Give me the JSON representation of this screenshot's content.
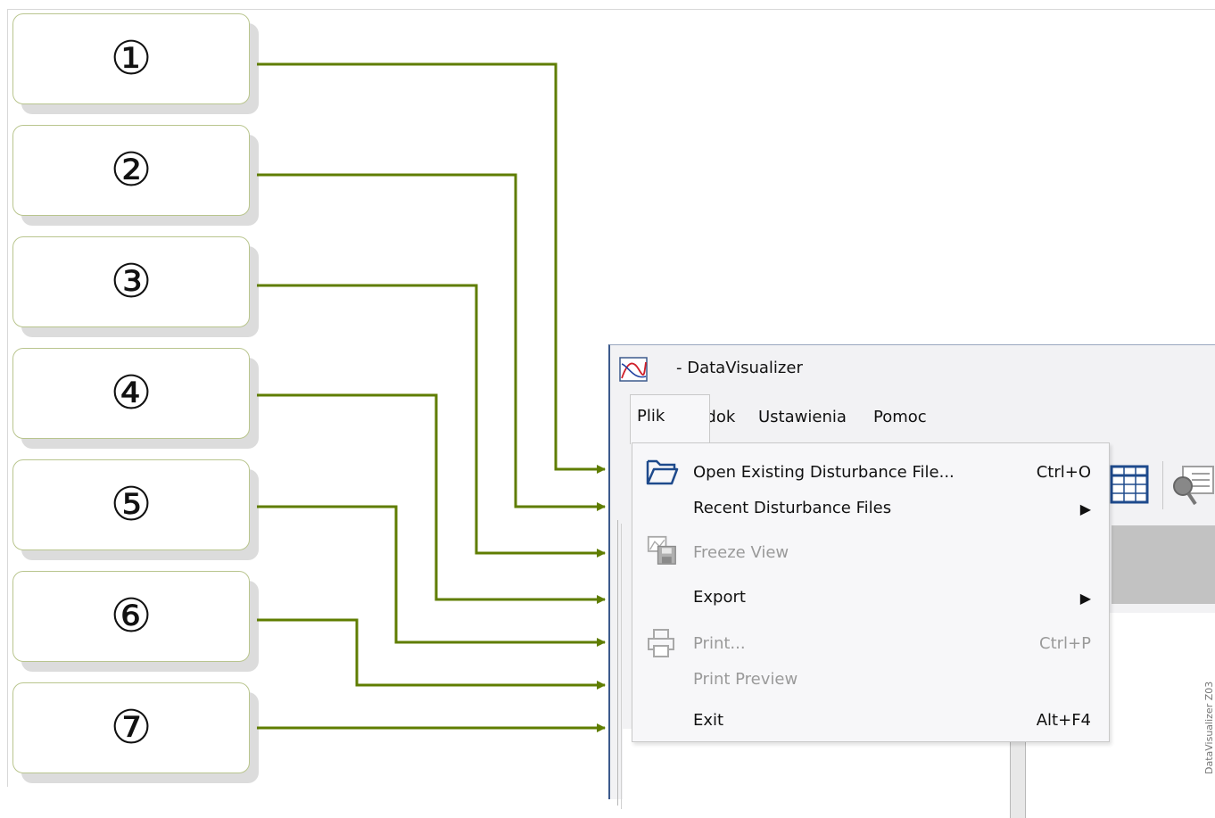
{
  "callouts": [
    {
      "num": "①"
    },
    {
      "num": "②"
    },
    {
      "num": "③"
    },
    {
      "num": "④"
    },
    {
      "num": "⑤"
    },
    {
      "num": "⑥"
    },
    {
      "num": "⑦"
    }
  ],
  "colors": {
    "connector": "#5f7d00",
    "callout_border": "#b9c58e",
    "window_border": "#3c5a8c"
  },
  "window": {
    "title": "- DataVisualizer",
    "app_icon": "chart-icon"
  },
  "menubar": {
    "items": [
      {
        "label": "Plik"
      },
      {
        "label": "Widok"
      },
      {
        "label": "Ustawienia"
      },
      {
        "label": "Pomoc"
      }
    ]
  },
  "dropdown": {
    "items": [
      {
        "label": "Open  Existing Disturbance File...",
        "shortcut": "Ctrl+O",
        "icon": "folder-open-icon",
        "enabled": true
      },
      {
        "label": "Recent Disturbance Files",
        "submenu": "▶",
        "enabled": true
      },
      {
        "label": "Freeze View",
        "icon": "freeze-view-icon",
        "enabled": false
      },
      {
        "label": "Export",
        "submenu": "▶",
        "enabled": true
      },
      {
        "label": "Print...",
        "shortcut": "Ctrl+P",
        "icon": "printer-icon",
        "enabled": false
      },
      {
        "label": "Print Preview",
        "enabled": false
      },
      {
        "label": "Exit",
        "shortcut": "Alt+F4",
        "enabled": true
      }
    ]
  },
  "toolbar": {
    "icons": [
      "table-grid-icon",
      "search-report-icon"
    ]
  },
  "side_caption": "DataVisualizer Z03"
}
